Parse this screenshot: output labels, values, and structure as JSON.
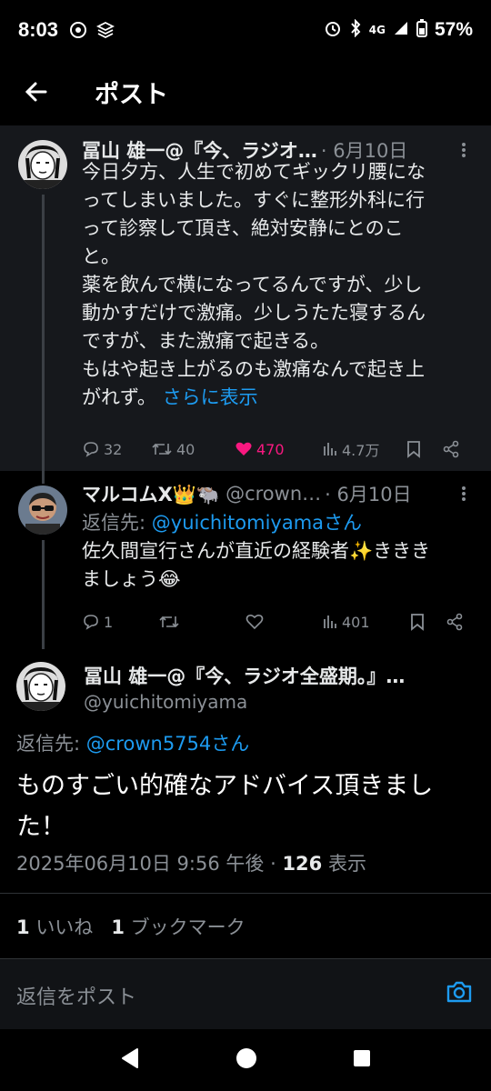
{
  "status_bar": {
    "time": "8:03",
    "network": "4G",
    "battery": "57%"
  },
  "app_bar": {
    "title": "ポスト"
  },
  "tweet1": {
    "name": "冨山 雄一@『今、ラジオ…",
    "date": "· 6月10日",
    "lines": [
      "今日夕方、人生で初めてギックリ腰にな",
      "ってしまいました。すぐに整形外科に行",
      "って診察して頂き、絶対安静にとのこ",
      "と。",
      "薬を飲んで横になってるんですが、少し",
      "動かすだけで激痛。少しうたた寝するん",
      "ですが、また激痛で起きる。",
      "もはや起き上がるのも激痛なんで起き上"
    ],
    "last_line": "がれず。",
    "show_more": "さらに表示",
    "replies": "32",
    "reposts": "40",
    "likes": "470",
    "views": "4.7万"
  },
  "tweet2": {
    "name": "マルコムX👑🐃",
    "handle": "@crown…",
    "date": "· 6月10日",
    "reply_prefix": "返信先:",
    "reply_handle": "@yuichitomiyamaさん",
    "lines": [
      "佐久間宣行さんが直近の経験者✨ききき",
      "ましょう😂"
    ],
    "replies": "1",
    "reposts": "",
    "likes": "",
    "views": "401"
  },
  "main_post": {
    "name": "冨山 雄一@『今、ラジオ全盛期。』…",
    "handle": "@yuichitomiyama",
    "reply_prefix": "返信先:",
    "reply_handle": "@crown5754さん",
    "text_line1": "ものすごい的確なアドバイス頂きまし",
    "text_line2": "た！",
    "timestamp": "2025年06月10日 9:56 午後 ·",
    "views_count": "126",
    "views_label": "表示",
    "likes_count": "1",
    "likes_label": "いいね",
    "bookmarks_count": "1",
    "bookmarks_label": "ブックマーク"
  },
  "composer": {
    "placeholder": "返信をポスト"
  },
  "colors": {
    "accent": "#1d9bf0",
    "like": "#f91880",
    "muted": "#8b9096"
  }
}
